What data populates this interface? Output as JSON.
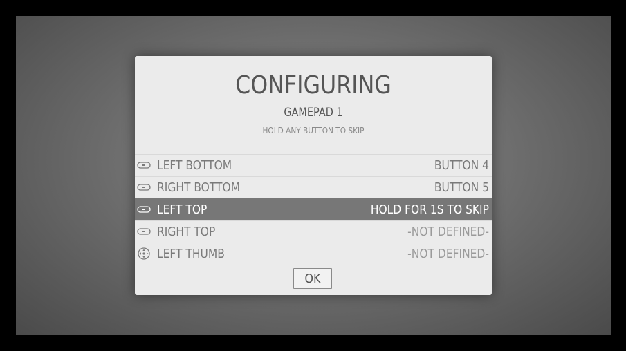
{
  "dialog": {
    "title": "CONFIGURING",
    "subtitle": "GAMEPAD 1",
    "hint": "HOLD ANY BUTTON TO SKIP",
    "ok_label": "OK"
  },
  "rows": [
    {
      "icon": "left-bumper-icon",
      "label": "LEFT BOTTOM",
      "value": "BUTTON 4"
    },
    {
      "icon": "right-bumper-icon",
      "label": "RIGHT BOTTOM",
      "value": "BUTTON 5"
    },
    {
      "icon": "left-trigger-icon",
      "label": "LEFT TOP",
      "value": "HOLD FOR 1S TO SKIP"
    },
    {
      "icon": "right-trigger-icon",
      "label": "RIGHT TOP",
      "value": "-NOT DEFINED-"
    },
    {
      "icon": "left-thumbstick-icon",
      "label": "LEFT THUMB",
      "value": "-NOT DEFINED-"
    }
  ],
  "selected_row_index": 2,
  "colors": {
    "dialog_background": "#ebebeb",
    "selected_row": "#777777",
    "text": "#555555"
  }
}
